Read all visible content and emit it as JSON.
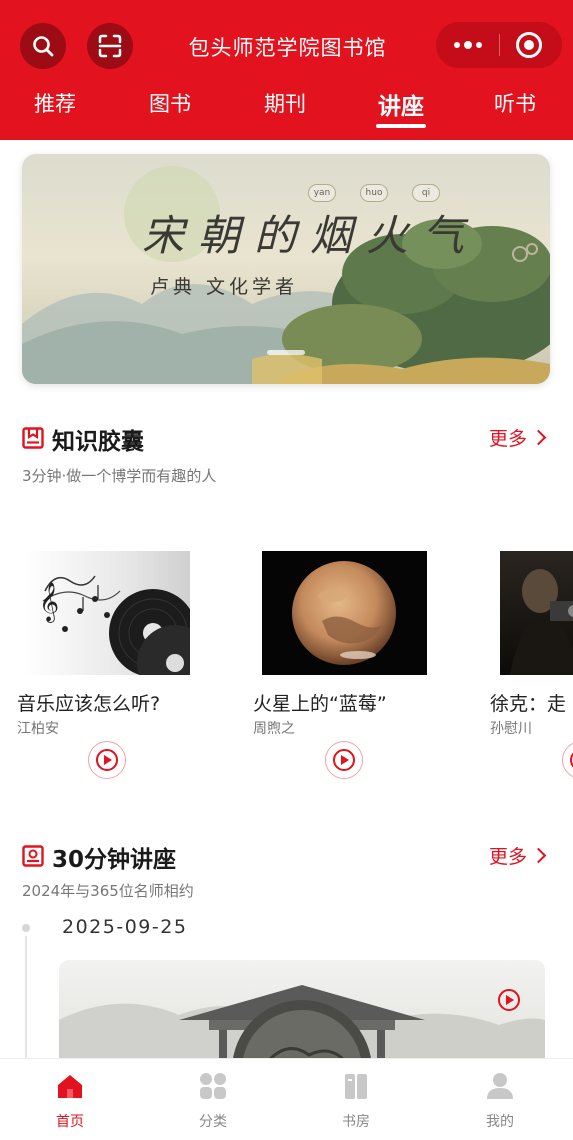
{
  "header": {
    "title": "包头师范学院图书馆",
    "tabs": [
      {
        "label": "推荐",
        "active": false
      },
      {
        "label": "图书",
        "active": false
      },
      {
        "label": "期刊",
        "active": false
      },
      {
        "label": "讲座",
        "active": true
      },
      {
        "label": "听书",
        "active": false
      }
    ],
    "icons": [
      "search-icon",
      "scan-icon",
      "more-icon",
      "target-icon"
    ]
  },
  "banner": {
    "title": "宋朝的烟火气",
    "pinyin": [
      "yan",
      "huo",
      "qi"
    ],
    "subtitle": "卢典 文化学者"
  },
  "knowledge_capsule": {
    "title": "知识胶囊",
    "more_label": "更多",
    "subtitle": "3分钟·做一个博学而有趣的人",
    "items": [
      {
        "title": "音乐应该怎么听?",
        "author": "江柏安"
      },
      {
        "title": "火星上的“蓝莓”",
        "author": "周煦之"
      },
      {
        "title": "徐克：走",
        "author": "孙慰川"
      }
    ]
  },
  "lectures": {
    "title": "30分钟讲座",
    "more_label": "更多",
    "subtitle": "2024年与365位名师相约",
    "date": "2025-09-25"
  },
  "bottom_nav": [
    {
      "label": "首页",
      "icon": "home-icon",
      "active": true
    },
    {
      "label": "分类",
      "icon": "category-icon",
      "active": false
    },
    {
      "label": "书房",
      "icon": "bookshelf-icon",
      "active": false
    },
    {
      "label": "我的",
      "icon": "profile-icon",
      "active": false
    }
  ],
  "colors": {
    "brand_red": "#e2121e",
    "dark_red": "#9d0c15"
  }
}
